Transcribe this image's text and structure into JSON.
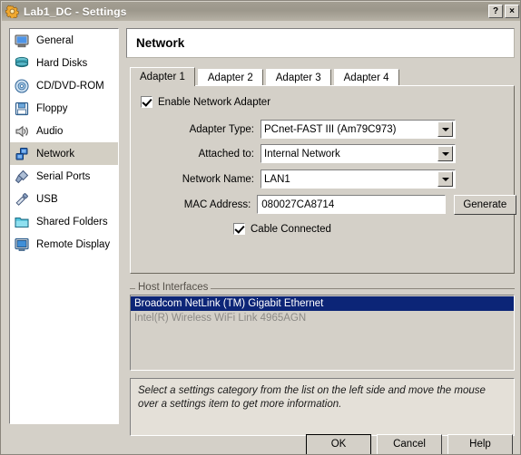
{
  "window": {
    "title": "Lab1_DC - Settings",
    "icon": "gear-icon",
    "help_button": "?",
    "close_button": "×"
  },
  "sidebar": {
    "items": [
      {
        "label": "General",
        "icon": "monitor-icon",
        "selected": false
      },
      {
        "label": "Hard Disks",
        "icon": "database-icon",
        "selected": false
      },
      {
        "label": "CD/DVD-ROM",
        "icon": "disc-icon",
        "selected": false
      },
      {
        "label": "Floppy",
        "icon": "floppy-icon",
        "selected": false
      },
      {
        "label": "Audio",
        "icon": "speaker-icon",
        "selected": false
      },
      {
        "label": "Network",
        "icon": "network-icon",
        "selected": true
      },
      {
        "label": "Serial Ports",
        "icon": "serial-plug-icon",
        "selected": false
      },
      {
        "label": "USB",
        "icon": "usb-icon",
        "selected": false
      },
      {
        "label": "Shared Folders",
        "icon": "folder-icon",
        "selected": false
      },
      {
        "label": "Remote Display",
        "icon": "remote-screen-icon",
        "selected": false
      }
    ]
  },
  "page": {
    "title": "Network",
    "tabs": [
      {
        "label": "Adapter 1",
        "active": true
      },
      {
        "label": "Adapter 2",
        "active": false
      },
      {
        "label": "Adapter 3",
        "active": false
      },
      {
        "label": "Adapter 4",
        "active": false
      }
    ]
  },
  "adapter": {
    "enable_label": "Enable Network Adapter",
    "enable_checked": true,
    "adapter_type_label": "Adapter Type:",
    "adapter_type_value": "PCnet-FAST III (Am79C973)",
    "attached_to_label": "Attached to:",
    "attached_to_value": "Internal Network",
    "network_name_label": "Network Name:",
    "network_name_value": "LAN1",
    "mac_address_label": "MAC Address:",
    "mac_address_value": "080027CA8714",
    "generate_label": "Generate",
    "cable_connected_label": "Cable Connected",
    "cable_connected_checked": true
  },
  "host_interfaces": {
    "group_label": "Host Interfaces",
    "items": [
      {
        "label": "Broadcom NetLink (TM) Gigabit Ethernet",
        "state": "selected"
      },
      {
        "label": "Intel(R) Wireless WiFi Link 4965AGN",
        "state": "disabled"
      }
    ]
  },
  "hint": {
    "text": "Select a settings category from the list on the left side and move the mouse over a settings item to get more information."
  },
  "buttons": {
    "ok": "OK",
    "cancel": "Cancel",
    "help": "Help"
  },
  "colors": {
    "dialog_face": "#d4d0c8",
    "selection_blue": "#0c2577",
    "titlebar": "#9c978b",
    "sidebar_selected": "#d3cfc4"
  }
}
